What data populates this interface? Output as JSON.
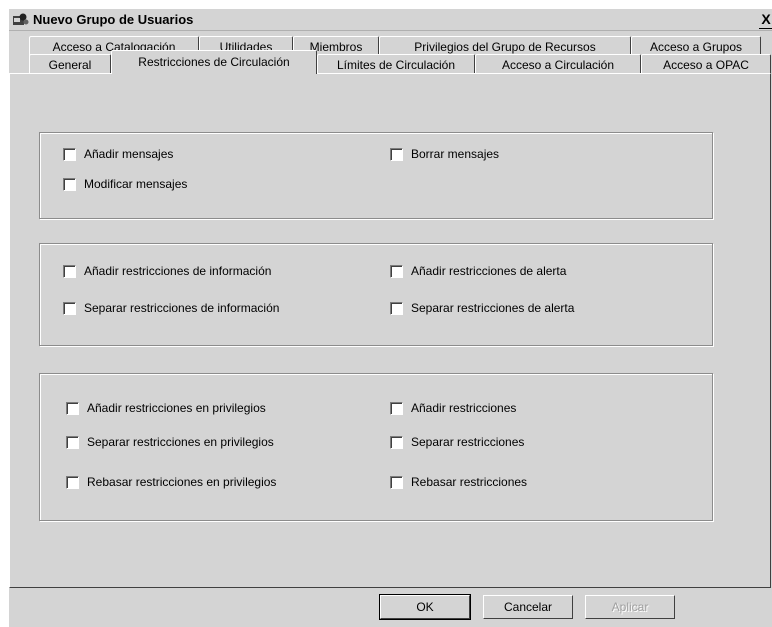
{
  "window": {
    "title": "Nuevo Grupo de Usuarios",
    "close_label": "X"
  },
  "tabs": {
    "back_row": [
      "Acceso a Catalogación",
      "Utilidades",
      "Miembros",
      "Privilegios del Grupo de Recursos",
      "Acceso a Grupos"
    ],
    "front_row": [
      "General",
      "Restricciones de Circulación",
      "Límites de Circulación",
      "Acceso a Circulación",
      "Acceso a OPAC"
    ],
    "active": "Restricciones de Circulación"
  },
  "groups": [
    {
      "checkboxes": [
        {
          "label": "Añadir mensajes",
          "checked": false
        },
        {
          "label": "Borrar mensajes",
          "checked": false
        },
        {
          "label": "Modificar mensajes",
          "checked": false
        }
      ]
    },
    {
      "checkboxes": [
        {
          "label": "Añadir restricciones de información",
          "checked": false
        },
        {
          "label": "Añadir restricciones de alerta",
          "checked": false
        },
        {
          "label": "Separar restricciones de información",
          "checked": false
        },
        {
          "label": "Separar restricciones de alerta",
          "checked": false
        }
      ]
    },
    {
      "checkboxes": [
        {
          "label": "Añadir restricciones en privilegios",
          "checked": false
        },
        {
          "label": "Añadir restricciones",
          "checked": false
        },
        {
          "label": "Separar restricciones en privilegios",
          "checked": false
        },
        {
          "label": "Separar restricciones",
          "checked": false
        },
        {
          "label": "Rebasar restricciones en privilegios",
          "checked": false
        },
        {
          "label": "Rebasar restricciones",
          "checked": false
        }
      ]
    }
  ],
  "buttons": {
    "ok": "OK",
    "cancel": "Cancelar",
    "apply": "Aplicar"
  }
}
